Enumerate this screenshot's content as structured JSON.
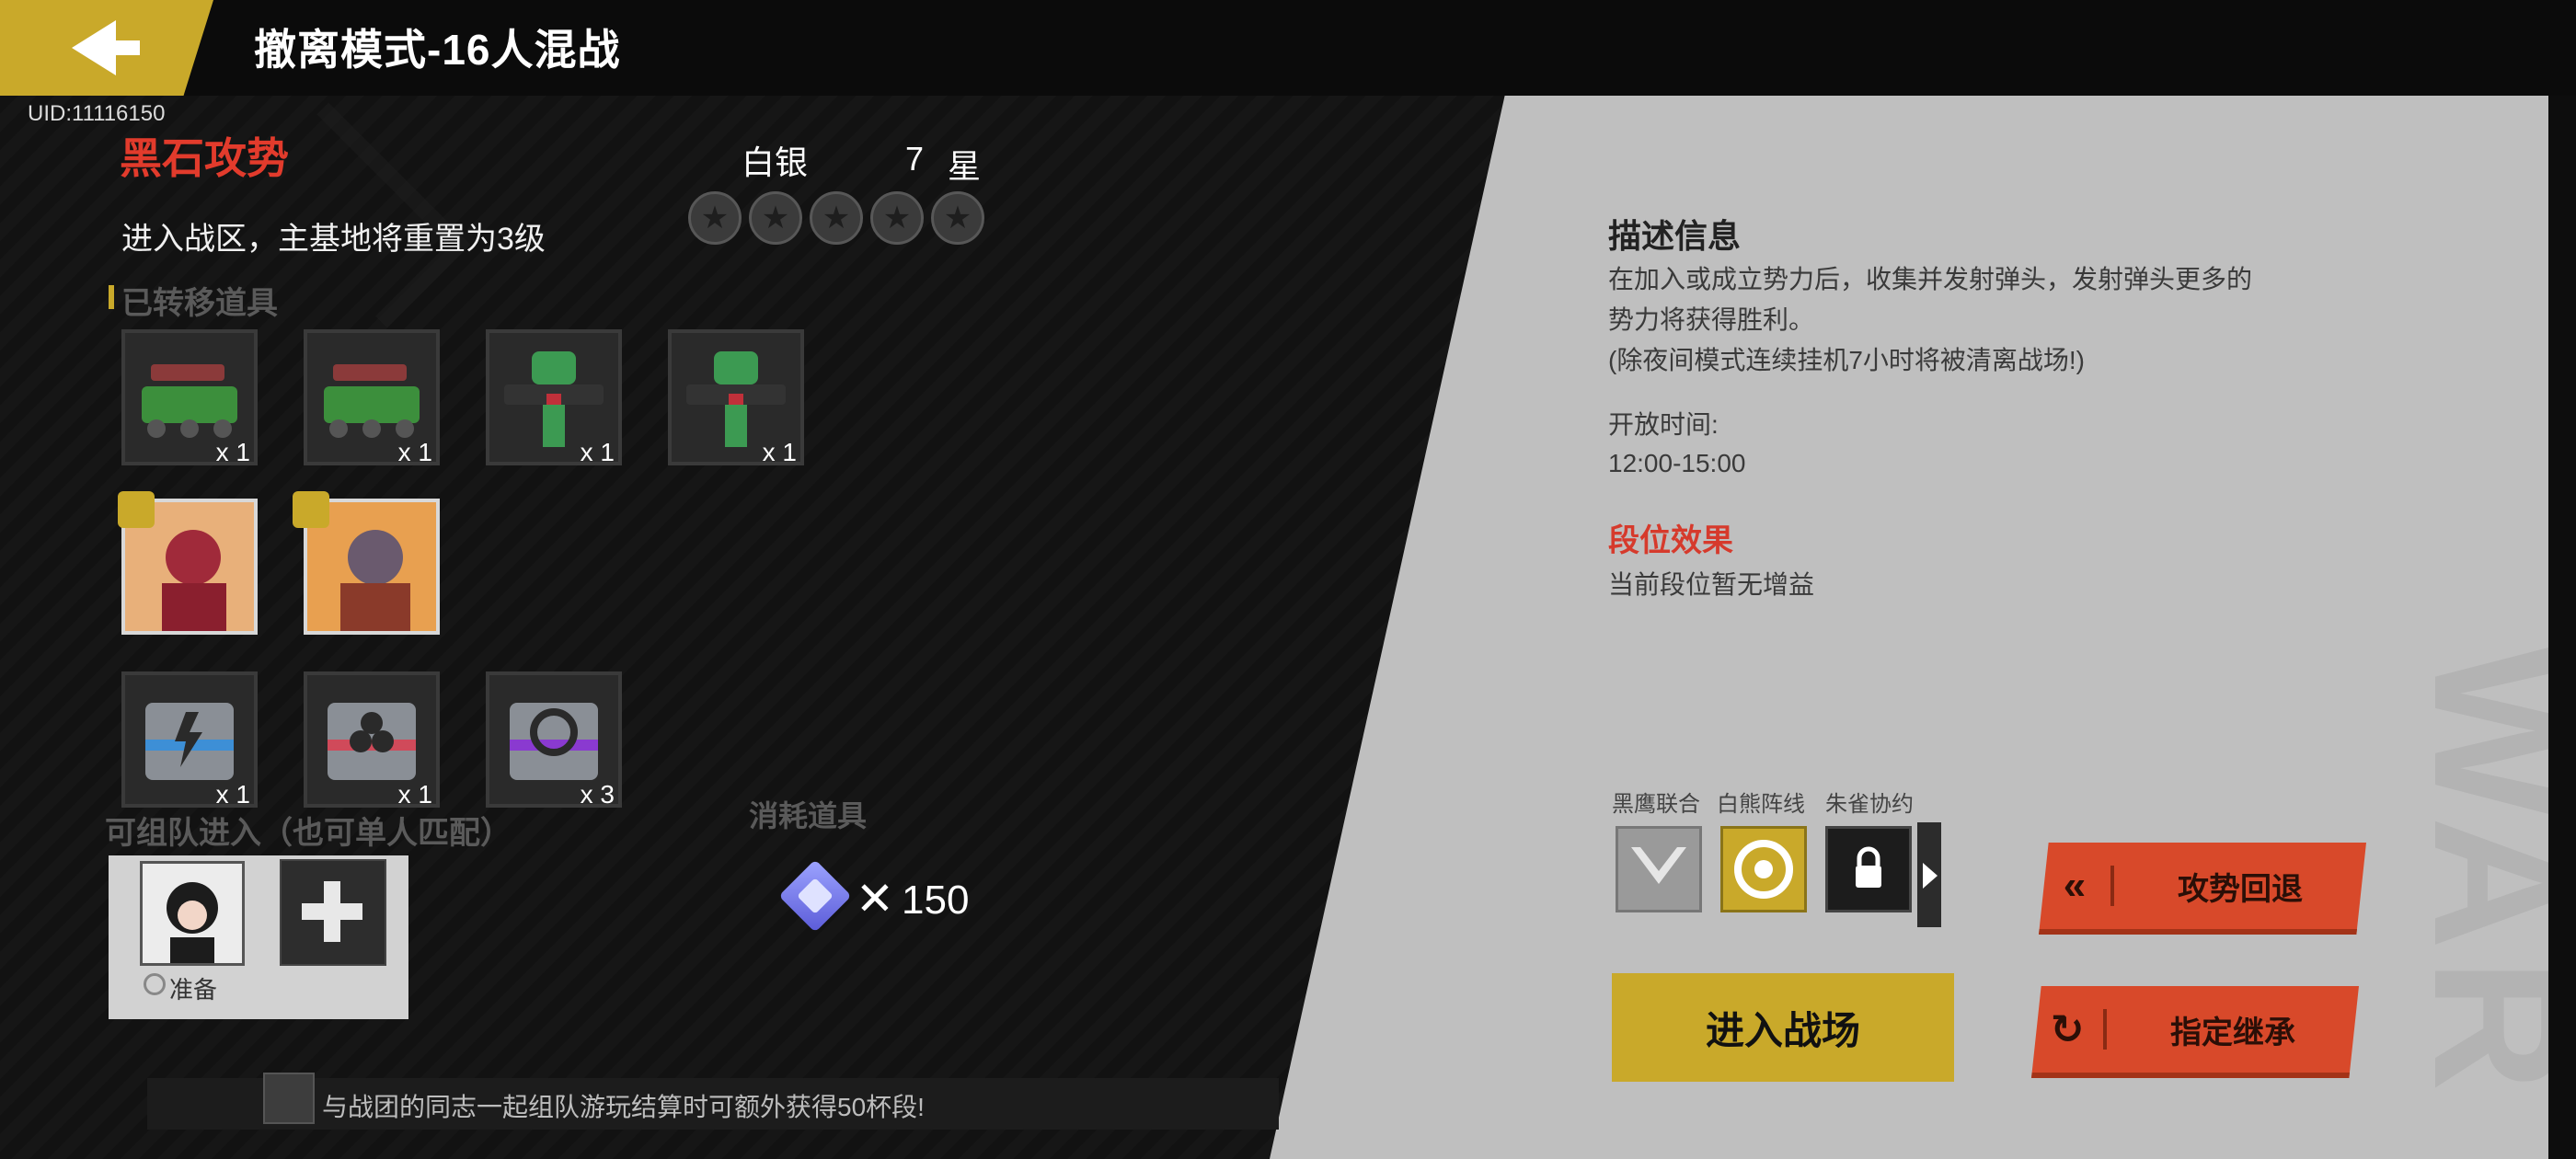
{
  "header": {
    "back_label": "",
    "title": "撤离模式-16人混战"
  },
  "uid": "UID:11116150",
  "mode": {
    "name": "黑石攻势",
    "description": "进入战区，主基地将重置为3级",
    "rank_name": "白银",
    "star_count": "7",
    "star_unit": "星",
    "stars_total": 5
  },
  "transferred": {
    "label": "已转移道具",
    "vehicles": [
      {
        "icon": "missile-tank-icon",
        "qty": "x 1"
      },
      {
        "icon": "missile-tank-icon",
        "qty": "x 1"
      },
      {
        "icon": "mech-walker-icon",
        "qty": "x 1"
      },
      {
        "icon": "mech-walker-icon",
        "qty": "x 1"
      }
    ],
    "heroes": [
      {
        "icon": "hero-card-icon"
      },
      {
        "icon": "hero-card-icon"
      }
    ],
    "chests": [
      {
        "icon": "blue-chest-icon",
        "qty": "x 1"
      },
      {
        "icon": "red-chest-icon",
        "qty": "x 1"
      },
      {
        "icon": "purple-chest-icon",
        "qty": "x 3"
      }
    ]
  },
  "team": {
    "label": "可组队进入（也可单人匹配）",
    "ready": "准备"
  },
  "consumable": {
    "label": "消耗道具",
    "times": "✕",
    "amount": "150"
  },
  "tip": "与战团的同志一起组队游玩结算时可额外获得50杯段!",
  "info": {
    "title": "描述信息",
    "lines": [
      "在加入或成立势力后，收集并发射弹头，发射弹头更多的",
      "势力将获得胜利。",
      "(除夜间模式连续挂机7小时将被清离战场!)"
    ],
    "open_label": "开放时间:",
    "open_time": "12:00-15:00",
    "rank_effect_title": "段位效果",
    "rank_effect_desc": "当前段位暂无增益"
  },
  "factions": [
    {
      "label": "黑鹰联合",
      "icon": "black-eagle-icon"
    },
    {
      "label": "白熊阵线",
      "icon": "white-bear-icon"
    },
    {
      "label": "朱雀协约",
      "icon": "lock-icon"
    }
  ],
  "buttons": {
    "enter": "进入战场",
    "retreat": "攻势回退",
    "retreat_icon": "«",
    "inherit": "指定继承",
    "inherit_icon": "↻"
  },
  "watermark": "WAR",
  "colors": {
    "accent_gold": "#c9a92a",
    "accent_red": "#d8492a",
    "title_red": "#e23b2c"
  }
}
